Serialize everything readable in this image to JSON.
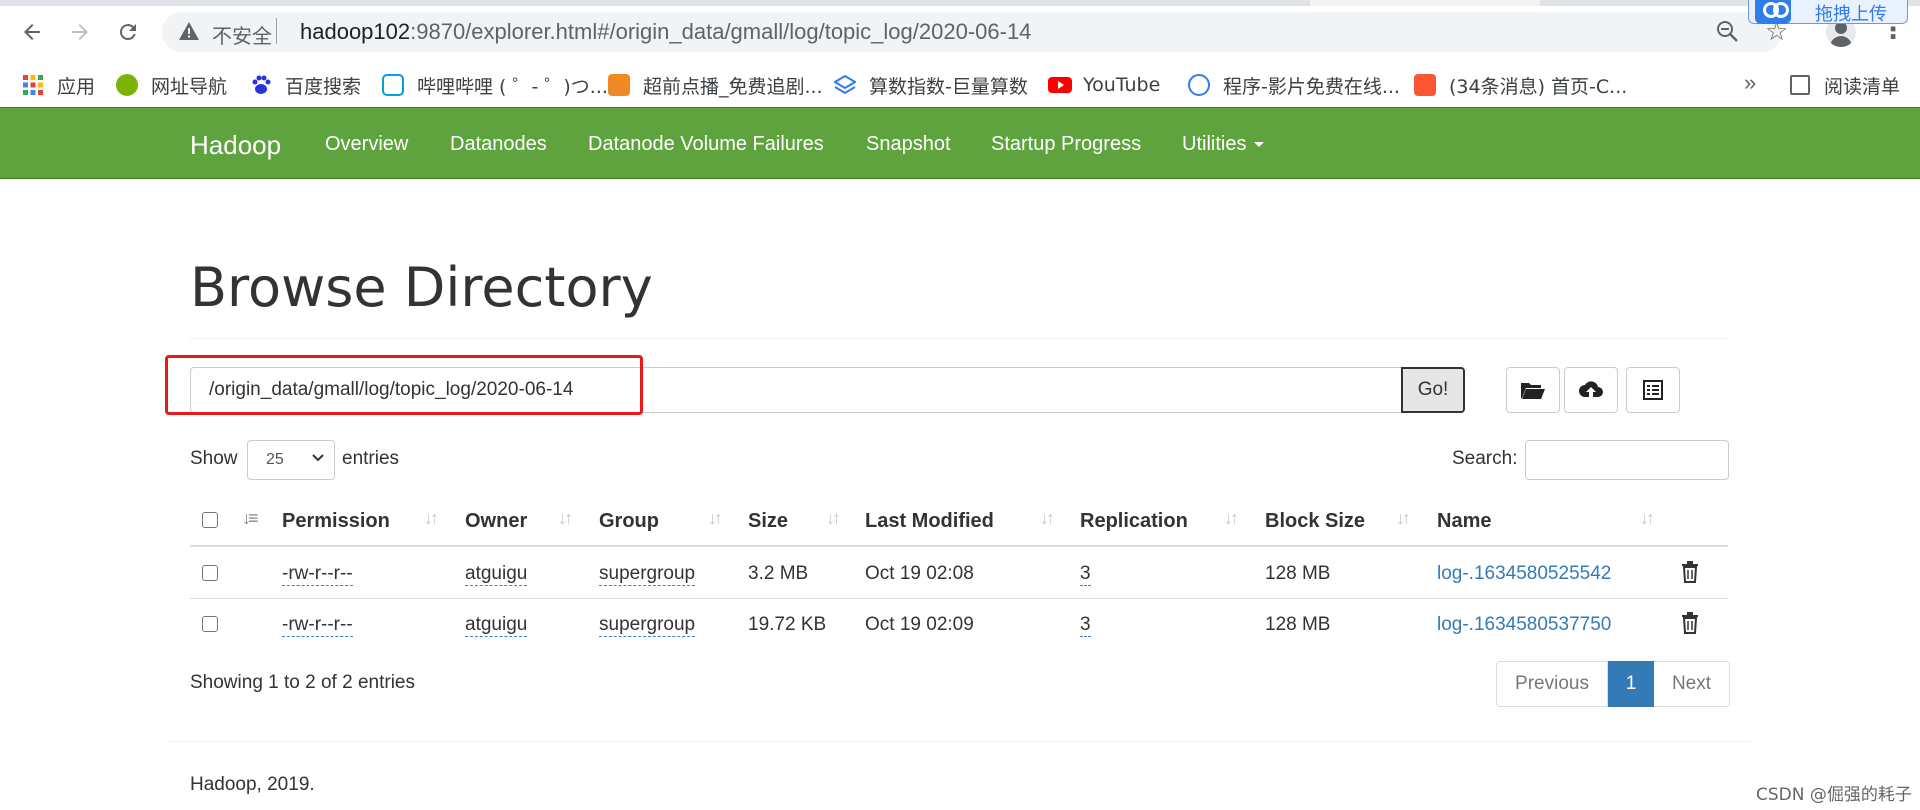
{
  "browser": {
    "insecure_label": "不安全",
    "url_host": "hadoop102",
    "url_rest": ":9870/explorer.html#/origin_data/gmall/log/topic_log/2020-06-14",
    "extension_label": "拖拽上传",
    "bookmarks": [
      {
        "label": "应用",
        "icon": "apps-grid-icon",
        "color": "#e94235"
      },
      {
        "label": "网址导航",
        "icon": "hao123-icon",
        "color": "#7cb305"
      },
      {
        "label": "百度搜索",
        "icon": "baidu-paw-icon",
        "color": "#2932e1"
      },
      {
        "label": "哔哩哔哩 ( ゜- ゜)つ...",
        "icon": "bilibili-icon",
        "color": "#00a1d6"
      },
      {
        "label": "超前点播_免费追剧...",
        "icon": "orange-box-icon",
        "color": "#f08a24"
      },
      {
        "label": "算数指数-巨量算数",
        "icon": "layers-icon",
        "color": "#2f7dea"
      },
      {
        "label": "YouTube",
        "icon": "youtube-icon",
        "color": "#ff0000"
      },
      {
        "label": "程序-影片免费在线...",
        "icon": "globe-icon",
        "color": "#2f7dea"
      },
      {
        "label": "(34条消息) 首页-C...",
        "icon": "csdn-icon",
        "color": "#fc5531"
      }
    ],
    "more_label": "»",
    "reading_list_label": "阅读清单"
  },
  "navbar": {
    "brand": "Hadoop",
    "links": [
      "Overview",
      "Datanodes",
      "Datanode Volume Failures",
      "Snapshot",
      "Startup Progress",
      "Utilities"
    ],
    "brand_color": "#5fa33e"
  },
  "page": {
    "title": "Browse Directory",
    "path_value": "/origin_data/gmall/log/topic_log/2020-06-14",
    "go_label": "Go!",
    "show_label": "Show",
    "entries_select_value": "25",
    "entries_label": "entries",
    "search_label": "Search:"
  },
  "table": {
    "headers": [
      "Permission",
      "Owner",
      "Group",
      "Size",
      "Last Modified",
      "Replication",
      "Block Size",
      "Name"
    ],
    "rows": [
      {
        "permission": "-rw-r--r--",
        "owner": "atguigu",
        "group": "supergroup",
        "size": "3.2 MB",
        "modified": "Oct 19 02:08",
        "replication": "3",
        "block_size": "128 MB",
        "name": "log-.1634580525542"
      },
      {
        "permission": "-rw-r--r--",
        "owner": "atguigu",
        "group": "supergroup",
        "size": "19.72 KB",
        "modified": "Oct 19 02:09",
        "replication": "3",
        "block_size": "128 MB",
        "name": "log-.1634580537750"
      }
    ]
  },
  "pagination": {
    "summary": "Showing 1 to 2 of 2 entries",
    "previous": "Previous",
    "current": "1",
    "next": "Next"
  },
  "footer": {
    "text": "Hadoop, 2019."
  },
  "watermark": "CSDN @倔强的耗子"
}
